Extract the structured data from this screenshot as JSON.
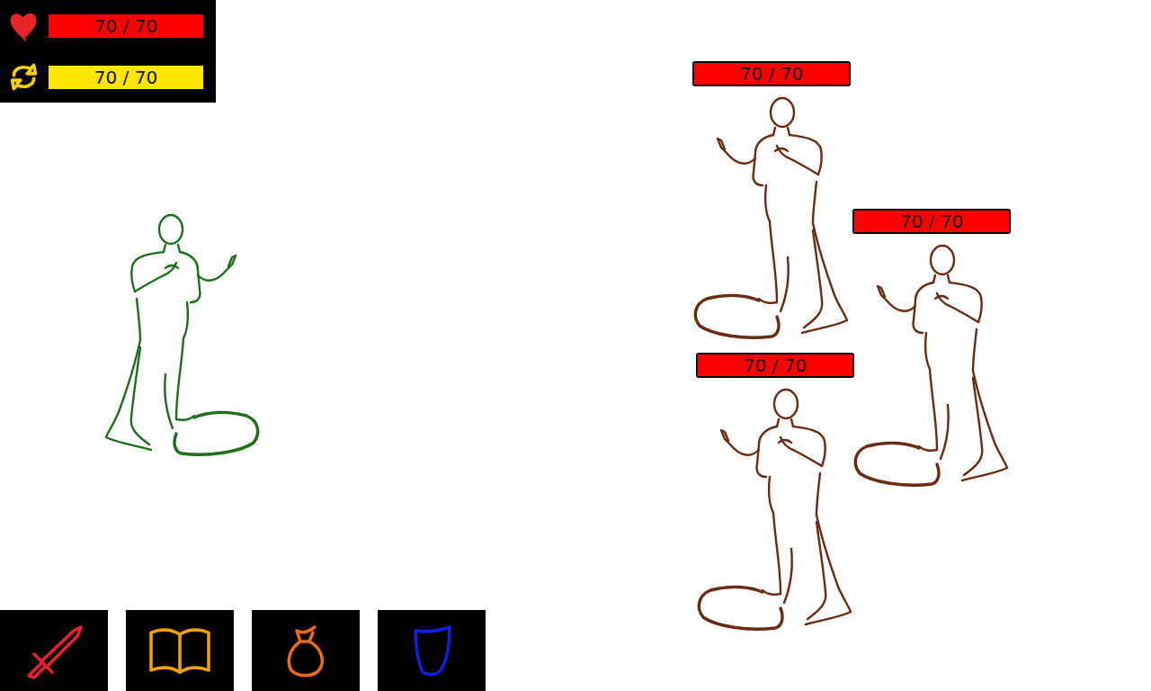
{
  "player": {
    "health": {
      "reading": "70 / 70",
      "level": 1
    },
    "energy": {
      "reading": "70 / 70",
      "level": 1
    },
    "color": "#1e6e1e"
  },
  "enemies": [
    {
      "health": {
        "reading": "70 / 70",
        "level": 1
      },
      "color": "#6b2a12"
    },
    {
      "health": {
        "reading": "70 / 70",
        "level": 1
      },
      "color": "#6b2a12"
    },
    {
      "health": {
        "reading": "70 / 70",
        "level": 1
      },
      "color": "#6b2a12"
    }
  ],
  "actions": [
    {
      "kind": "attack",
      "color": "#e8232a"
    },
    {
      "kind": "spell",
      "color": "#f5a300"
    },
    {
      "kind": "item",
      "color": "#f06a10"
    },
    {
      "kind": "defend",
      "color": "#1020e0"
    }
  ]
}
